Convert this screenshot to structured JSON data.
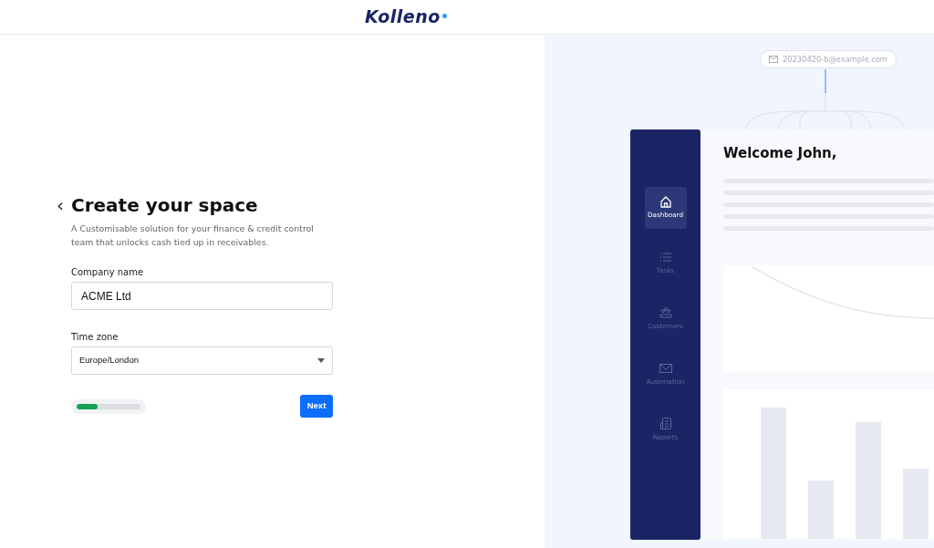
{
  "header": {
    "logo": "Kolleno"
  },
  "form": {
    "back": "‹",
    "title": "Create your space",
    "subtitle": "A Customisable solution for your finance & credit control team that unlocks cash tied up in receivables.",
    "fields": [
      {
        "kind": "text",
        "label": "Company name",
        "value": "ACME Ltd"
      },
      {
        "kind": "select",
        "label": "Time zone",
        "value": "Europe/London"
      }
    ],
    "progress": {
      "level": 0.33
    },
    "next_button": "Next"
  },
  "preview": {
    "email": "20230420-b@example.com",
    "welcome": "Welcome John,",
    "nav": [
      {
        "label": "Dashboard",
        "kind": "home",
        "selected": true
      },
      {
        "label": "Tasks",
        "kind": "list",
        "selected": false
      },
      {
        "label": "Customers",
        "kind": "people",
        "selected": false
      },
      {
        "label": "Automation",
        "kind": "mail",
        "selected": false
      },
      {
        "label": "Reports",
        "kind": "report",
        "selected": false
      }
    ]
  }
}
